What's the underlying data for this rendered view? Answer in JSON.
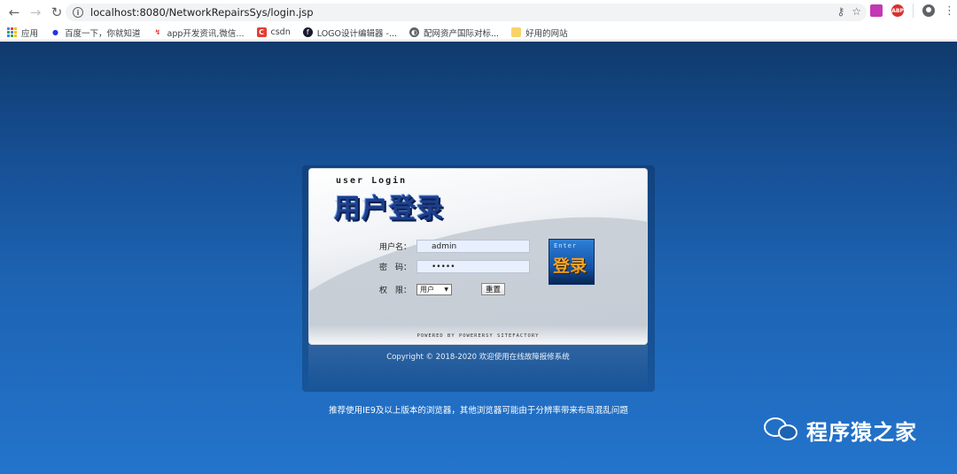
{
  "browser": {
    "url": "localhost:8080/NetworkRepairsSys/login.jsp",
    "bookmarks": [
      {
        "label": "应用",
        "icon": "apps-grid-icon"
      },
      {
        "label": "百度一下，你就知道",
        "icon": "baidu-paw-icon"
      },
      {
        "label": "app开发资讯,微信...",
        "icon": "app-dev-icon"
      },
      {
        "label": "csdn",
        "icon": "csdn-icon"
      },
      {
        "label": "LOGO设计编辑器 -...",
        "icon": "logo-design-icon"
      },
      {
        "label": "配网资产国际对标...",
        "icon": "globe-icon"
      },
      {
        "label": "好用的网站",
        "icon": "folder-icon"
      }
    ],
    "ext_abp": "ABP"
  },
  "login": {
    "title_en": "user Login",
    "title_cn": "用户登录",
    "username_label": "用户名：",
    "username_value": "admin",
    "password_label": "密　码：",
    "password_value": "•••••",
    "role_label": "权　限：",
    "role_selected": "用户",
    "reset_label": "重置",
    "enter_en": "Enter",
    "enter_cn": "登录",
    "powered_by": "POWERED BY POWERERSY SITEFACTORY"
  },
  "footer": {
    "copyright": "Copyright © 2018-2020 欢迎使用在线故障报修系统",
    "recommend": "推荐使用IE9及以上版本的浏览器，其他浏览器可能由于分辨率带来布局混乱问题"
  },
  "watermark": {
    "text": "程序猿之家",
    "icon": "wechat-icon"
  }
}
